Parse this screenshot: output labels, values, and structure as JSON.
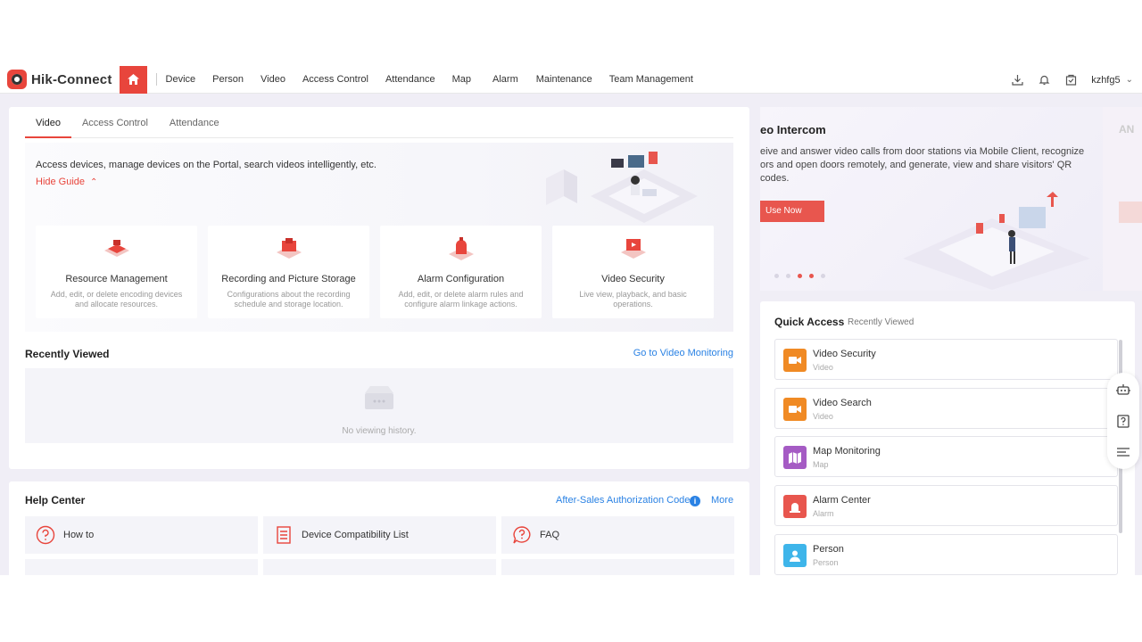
{
  "brand": {
    "name": "Hik-Connect"
  },
  "nav": {
    "items": [
      "Device",
      "Person",
      "Video",
      "Access Control",
      "Attendance",
      "Map",
      "Alarm",
      "Maintenance",
      "Team Management"
    ],
    "user": "kzhfg5"
  },
  "main": {
    "tabs": [
      "Video",
      "Access Control",
      "Attendance"
    ],
    "active_tab": "Video",
    "guide_text": "Access devices, manage devices on the Portal, search videos intelligently, etc.",
    "hide_guide": "Hide Guide",
    "features": [
      {
        "title": "Resource Management",
        "desc": "Add, edit, or delete encoding devices and allocate resources."
      },
      {
        "title": "Recording and Picture Storage",
        "desc": "Configurations about the recording schedule and storage location."
      },
      {
        "title": "Alarm Configuration",
        "desc": "Add, edit, or delete alarm rules and configure alarm linkage actions."
      },
      {
        "title": "Video Security",
        "desc": "Live view, playback, and basic operations."
      }
    ],
    "recently_viewed": {
      "title": "Recently Viewed",
      "link": "Go to Video Monitoring",
      "empty": "No viewing history."
    }
  },
  "help": {
    "title": "Help Center",
    "auth_link": "After-Sales Authorization Code",
    "more": "More",
    "items": [
      "How to",
      "Device Compatibility List",
      "FAQ"
    ]
  },
  "banner": {
    "title": "eo Intercom",
    "desc_line1": "eive and answer video calls from door stations via Mobile Client, recognize",
    "desc_line2": "ors and open doors remotely, and generate, view and share visitors' QR codes.",
    "button": "Use Now",
    "next_title": "AN"
  },
  "quick_access": {
    "title": "Quick Access",
    "tab2": "Recently Viewed",
    "items": [
      {
        "title": "Video Security",
        "desc": "Video",
        "color": "#f08a24"
      },
      {
        "title": "Video Search",
        "desc": "Video",
        "color": "#f08a24"
      },
      {
        "title": "Map Monitoring",
        "desc": "Map",
        "color": "#a55bc4"
      },
      {
        "title": "Alarm Center",
        "desc": "Alarm",
        "color": "#e8564e"
      },
      {
        "title": "Person",
        "desc": "Person",
        "color": "#3eb5ea"
      }
    ]
  },
  "colors": {
    "accent": "#e8453c",
    "link": "#2a82e4"
  }
}
